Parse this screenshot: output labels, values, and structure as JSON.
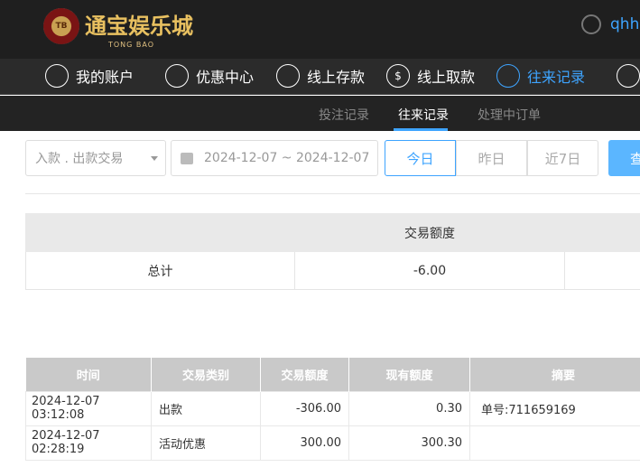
{
  "header": {
    "logo_text": "通宝娱乐城",
    "logo_sub": "TONG BAO",
    "logo_chip": "TB",
    "username": "qhhw"
  },
  "nav": [
    {
      "label": "我的账户",
      "icon": "user-icon"
    },
    {
      "label": "优惠中心",
      "icon": "gift-icon"
    },
    {
      "label": "线上存款",
      "icon": "deposit-icon"
    },
    {
      "label": "线上取款",
      "icon": "withdraw-icon"
    },
    {
      "label": "往来记录",
      "icon": "records-icon",
      "active": true
    },
    {
      "label": "",
      "icon": "bell-icon"
    }
  ],
  "subnav": [
    {
      "label": "投注记录"
    },
    {
      "label": "往来记录",
      "active": true
    },
    {
      "label": "处理中订单"
    }
  ],
  "filter": {
    "type": "入款 . 出款交易",
    "date_range": "2024-12-07 ~ 2024-12-07",
    "quick": [
      "今日",
      "昨日",
      "近7日"
    ],
    "search": "查"
  },
  "summary": {
    "header": "交易额度",
    "label": "总计",
    "value": "-6.00"
  },
  "details": {
    "columns": [
      "时间",
      "交易类别",
      "交易额度",
      "现有额度",
      "摘要"
    ],
    "rows": [
      [
        "2024-12-07 03:12:08",
        "出款",
        "-306.00",
        "0.30",
        "单号:711659169"
      ],
      [
        "2024-12-07 02:28:19",
        "活动优惠",
        "300.00",
        "300.30",
        ""
      ]
    ]
  },
  "colors": {
    "accent": "#3ea4ff",
    "header_bg": "#1f1f1f"
  }
}
